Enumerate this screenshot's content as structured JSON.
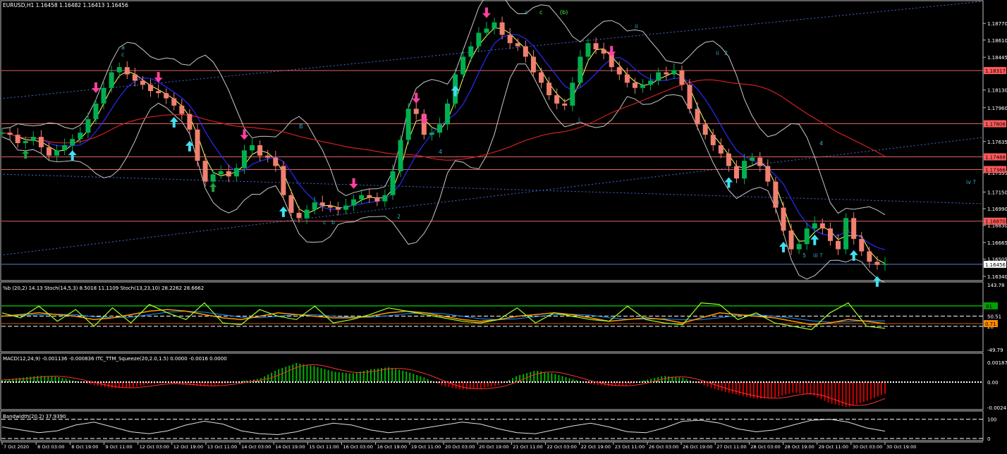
{
  "header": {
    "symbol_line": "EURUSD,H1  1.16458 1.16482 1.16413 1.16456"
  },
  "colors": {
    "background": "#000000",
    "frame": "#c0c0c0",
    "bull_candle": "#00b050",
    "bear_candle": "#f08070",
    "sr_line": "#e06060",
    "bollinger": "#c8c8c8",
    "ma_fast": "#ffff66",
    "ma_mid": "#2a2aff",
    "ma_slow": "#d02020",
    "trend_dots": "#4a6ad8",
    "arrow_up": "#40e0f0",
    "arrow_down": "#ff40a0",
    "arrow_up_small": "#20a040",
    "stoch_green": "#a0ff30",
    "stoch_orange": "#ff9900",
    "stoch_blue": "#1e90ff",
    "macd_green": "#00b000",
    "macd_red": "#d00000",
    "bandwidth": "#e0e0e0",
    "price_label_bg": "#ff5a5a",
    "current_price_bg": "#ffffff"
  },
  "price_axis": {
    "ticks": [
      "1.18770",
      "1.18610",
      "1.18445",
      "1.18130",
      "1.17960",
      "1.17635",
      "1.17335",
      "1.17150",
      "1.16990",
      "1.16830",
      "1.16665",
      "1.16505",
      "1.16340"
    ],
    "sr_labels": [
      "1.18317",
      "1.17806",
      "1.17488",
      "1.17366",
      "1.16870"
    ],
    "current": "1.16456"
  },
  "wave_labels": [
    {
      "text": "a"
    },
    {
      "text": "c"
    },
    {
      "text": "B"
    },
    {
      "text": "b"
    },
    {
      "text": "c"
    },
    {
      "text": "2"
    },
    {
      "text": "4"
    },
    {
      "text": "c"
    },
    {
      "text": "c"
    },
    {
      "text": "(b)"
    },
    {
      "text": "ii"
    },
    {
      "text": "i"
    },
    {
      "text": "1"
    },
    {
      "text": "2"
    },
    {
      "text": "3"
    },
    {
      "text": "4"
    },
    {
      "text": "5"
    },
    {
      "text": "iii ?"
    },
    {
      "text": "iv ?"
    },
    {
      "text": "ii"
    }
  ],
  "stoch_panel": {
    "label": "%b (20,2) 14.13  Stoch(14,5,3) 8.5018 11.1109  Stoch(13,23,10) 28.2262 28.6662",
    "ticks": [
      "143.78",
      "81",
      "50.51",
      "20",
      "-49.79"
    ],
    "label_81": "81",
    "label_071": "0.71"
  },
  "macd_panel": {
    "label": "MACD(12,24,9) -0.001136 -0.000836  ITC_TTM_Squeeze(20,2.0,1.5) 0.0000 -0.0016 0.0000",
    "ticks": [
      "0.001871",
      "0.00",
      "-0.002411"
    ]
  },
  "bw_panel": {
    "label": "Bandwidth(20,2) 37.9390",
    "ticks": [
      "100",
      "0"
    ]
  },
  "time_axis": [
    "7 Oct 2020",
    "8 Oct 03:00",
    "8 Oct 19:00",
    "9 Oct 11:00",
    "12 Oct 03:00",
    "12 Oct 19:00",
    "13 Oct 11:00",
    "14 Oct 03:00",
    "14 Oct 19:00",
    "15 Oct 11:00",
    "16 Oct 03:00",
    "16 Oct 19:00",
    "19 Oct 11:00",
    "20 Oct 03:00",
    "20 Oct 19:00",
    "21 Oct 11:00",
    "22 Oct 03:00",
    "22 Oct 19:00",
    "23 Oct 11:00",
    "26 Oct 03:00",
    "26 Oct 19:00",
    "27 Oct 11:00",
    "28 Oct 03:00",
    "28 Oct 19:00",
    "29 Oct 11:00",
    "30 Oct 03:00",
    "30 Oct 19:00"
  ],
  "chart_data": {
    "type": "line",
    "y_range": [
      1.1634,
      1.189
    ],
    "support_resistance": [
      1.18317,
      1.17806,
      1.17488,
      1.17366,
      1.1687
    ],
    "close": [
      1.1772,
      1.177,
      1.1762,
      1.1764,
      1.1768,
      1.1758,
      1.175,
      1.1755,
      1.176,
      1.1766,
      1.1772,
      1.1785,
      1.18,
      1.1815,
      1.183,
      1.1835,
      1.1828,
      1.1822,
      1.1818,
      1.1812,
      1.181,
      1.1805,
      1.1798,
      1.179,
      1.1775,
      1.1745,
      1.1725,
      1.1732,
      1.1735,
      1.173,
      1.1738,
      1.1755,
      1.176,
      1.175,
      1.1748,
      1.174,
      1.1712,
      1.1695,
      1.169,
      1.1698,
      1.1705,
      1.1702,
      1.17,
      1.1698,
      1.1702,
      1.1708,
      1.1712,
      1.171,
      1.1706,
      1.1712,
      1.1735,
      1.1765,
      1.1795,
      1.179,
      1.177,
      1.1772,
      1.178,
      1.18,
      1.1828,
      1.1845,
      1.1855,
      1.1868,
      1.1872,
      1.1878,
      1.1866,
      1.1858,
      1.1855,
      1.1845,
      1.183,
      1.182,
      1.1808,
      1.18,
      1.1798,
      1.182,
      1.1845,
      1.1858,
      1.1852,
      1.1848,
      1.1835,
      1.1828,
      1.182,
      1.1815,
      1.1818,
      1.1822,
      1.183,
      1.1828,
      1.1832,
      1.1818,
      1.1795,
      1.178,
      1.177,
      1.176,
      1.1752,
      1.174,
      1.1728,
      1.1745,
      1.1748,
      1.174,
      1.1725,
      1.17,
      1.1678,
      1.166,
      1.1665,
      1.168,
      1.1685,
      1.168,
      1.1668,
      1.166,
      1.169,
      1.167,
      1.1658,
      1.1648,
      1.1645,
      1.1646
    ],
    "series_meta": [
      "close",
      "bollinger_upper",
      "bollinger_lower",
      "ma_fast",
      "ma_mid",
      "ma_slow"
    ],
    "stoch": {
      "percent_b": [
        60,
        45,
        80,
        35,
        70,
        20,
        75,
        30,
        85,
        60,
        40,
        90,
        30,
        25,
        70,
        50,
        40,
        80,
        30,
        40,
        55,
        75,
        65,
        55,
        45,
        35,
        30,
        40,
        75,
        30,
        60,
        50,
        40,
        35,
        80,
        40,
        30,
        25,
        90,
        85,
        40,
        60,
        30,
        20,
        10,
        60,
        90,
        20,
        14
      ],
      "orange": [
        50,
        55,
        60,
        55,
        50,
        40,
        45,
        55,
        65,
        70,
        65,
        55,
        45,
        40,
        50,
        60,
        55,
        50,
        45,
        45,
        50,
        60,
        65,
        60,
        50,
        40,
        35,
        40,
        50,
        55,
        60,
        55,
        45,
        35,
        40,
        45,
        40,
        30,
        45,
        60,
        55,
        50,
        45,
        35,
        25,
        30,
        40,
        35,
        28
      ]
    },
    "macd": [
      0.0002,
      0.0004,
      0.0006,
      0.0005,
      0.0001,
      -0.0003,
      -0.0006,
      -0.0005,
      -0.0002,
      -0.0001,
      -0.0003,
      -0.0004,
      -0.0002,
      0.0001,
      0.0003,
      0.0012,
      0.0018,
      0.0015,
      0.001,
      0.0008,
      0.0012,
      0.0014,
      0.001,
      0.0004,
      -0.0004,
      -0.0007,
      -0.0006,
      -0.0003,
      0.0006,
      0.0011,
      0.0008,
      0.0003,
      -0.0002,
      -0.0004,
      -0.0003,
      0.0002,
      0.0006,
      0.0004,
      -0.0002,
      -0.0008,
      -0.0012,
      -0.0016,
      -0.0015,
      -0.001,
      -0.0012,
      -0.002,
      -0.0024,
      -0.0018,
      -0.0011
    ],
    "bandwidth": [
      60,
      45,
      30,
      40,
      70,
      85,
      60,
      35,
      25,
      40,
      70,
      90,
      75,
      40,
      25,
      20,
      35,
      60,
      80,
      70,
      45,
      30,
      40,
      55,
      70,
      85,
      75,
      50,
      30,
      25,
      45,
      65,
      80,
      60,
      35,
      30,
      55,
      90,
      95,
      80,
      50,
      35,
      45,
      70,
      95,
      100,
      85,
      55,
      38
    ]
  }
}
